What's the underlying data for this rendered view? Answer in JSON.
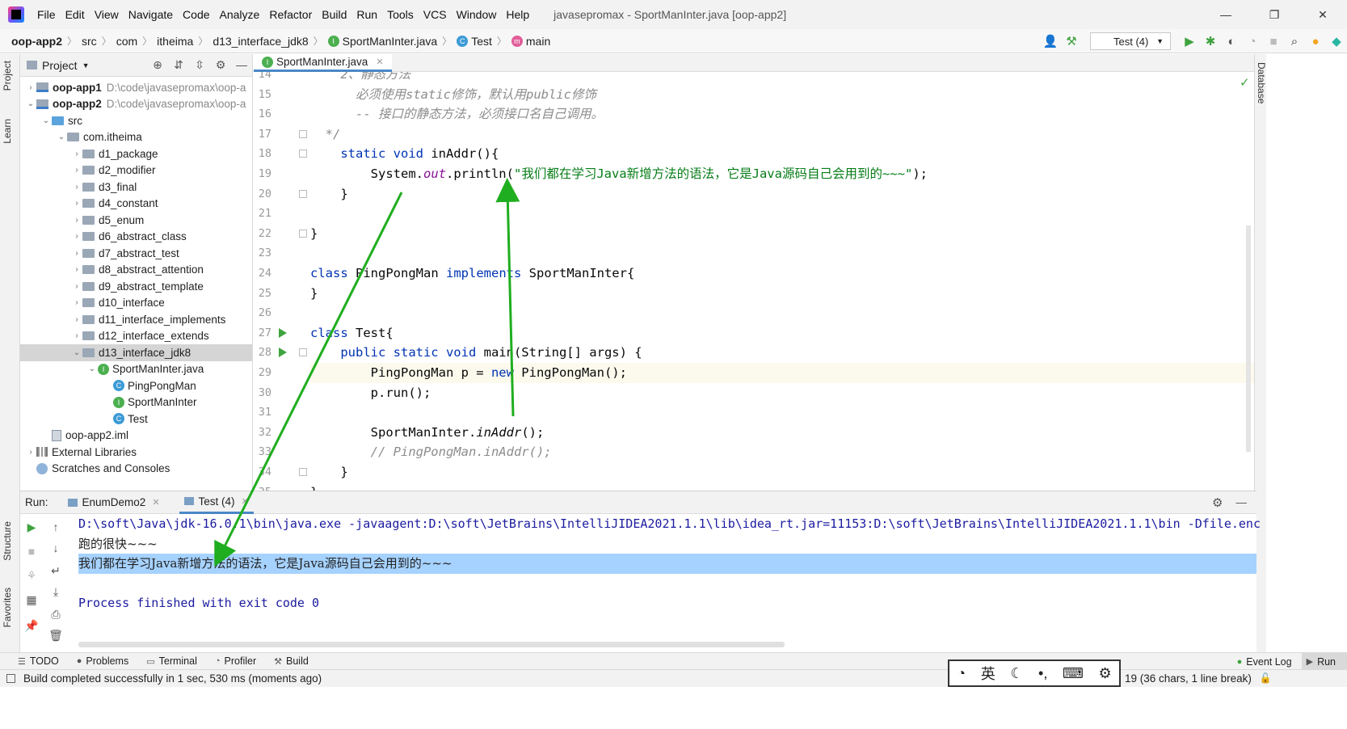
{
  "menubar": {
    "items": [
      "File",
      "Edit",
      "View",
      "Navigate",
      "Code",
      "Analyze",
      "Refactor",
      "Build",
      "Run",
      "Tools",
      "VCS",
      "Window",
      "Help"
    ],
    "window_title": "javasepromax - SportManInter.java [oop-app2]"
  },
  "navbar": {
    "crumbs": [
      "oop-app2",
      "src",
      "com",
      "itheima",
      "d13_interface_jdk8",
      "SportManInter.java",
      "Test",
      "main"
    ],
    "run_config": "Test (4)"
  },
  "left_strip": {
    "project": "Project",
    "learn": "Learn",
    "structure": "Structure",
    "favorites": "Favorites"
  },
  "right_strip": {
    "database": "Database"
  },
  "project": {
    "title": "Project",
    "tree": [
      {
        "label": "oop-app1",
        "path": "D:\\code\\javasepromax\\oop-a",
        "depth": 0,
        "arrow": "›",
        "kind": "module"
      },
      {
        "label": "oop-app2",
        "path": "D:\\code\\javasepromax\\oop-a",
        "depth": 0,
        "arrow": "⌄",
        "kind": "module"
      },
      {
        "label": "src",
        "depth": 1,
        "arrow": "⌄",
        "kind": "src"
      },
      {
        "label": "com.itheima",
        "depth": 2,
        "arrow": "⌄",
        "kind": "folder"
      },
      {
        "label": "d1_package",
        "depth": 3,
        "arrow": "›",
        "kind": "folder"
      },
      {
        "label": "d2_modifier",
        "depth": 3,
        "arrow": "›",
        "kind": "folder"
      },
      {
        "label": "d3_final",
        "depth": 3,
        "arrow": "›",
        "kind": "folder"
      },
      {
        "label": "d4_constant",
        "depth": 3,
        "arrow": "›",
        "kind": "folder"
      },
      {
        "label": "d5_enum",
        "depth": 3,
        "arrow": "›",
        "kind": "folder"
      },
      {
        "label": "d6_abstract_class",
        "depth": 3,
        "arrow": "›",
        "kind": "folder"
      },
      {
        "label": "d7_abstract_test",
        "depth": 3,
        "arrow": "›",
        "kind": "folder"
      },
      {
        "label": "d8_abstract_attention",
        "depth": 3,
        "arrow": "›",
        "kind": "folder"
      },
      {
        "label": "d9_abstract_template",
        "depth": 3,
        "arrow": "›",
        "kind": "folder"
      },
      {
        "label": "d10_interface",
        "depth": 3,
        "arrow": "›",
        "kind": "folder"
      },
      {
        "label": "d11_interface_implements",
        "depth": 3,
        "arrow": "›",
        "kind": "folder"
      },
      {
        "label": "d12_interface_extends",
        "depth": 3,
        "arrow": "›",
        "kind": "folder"
      },
      {
        "label": "d13_interface_jdk8",
        "depth": 3,
        "arrow": "⌄",
        "kind": "folder",
        "selected": true
      },
      {
        "label": "SportManInter.java",
        "depth": 4,
        "arrow": "⌄",
        "kind": "interface"
      },
      {
        "label": "PingPongMan",
        "depth": 5,
        "arrow": "",
        "kind": "class"
      },
      {
        "label": "SportManInter",
        "depth": 5,
        "arrow": "",
        "kind": "interface"
      },
      {
        "label": "Test",
        "depth": 5,
        "arrow": "",
        "kind": "class-run"
      },
      {
        "label": "oop-app2.iml",
        "depth": 1,
        "arrow": "",
        "kind": "iml"
      },
      {
        "label": "External Libraries",
        "depth": 0,
        "arrow": "›",
        "kind": "libs"
      },
      {
        "label": "Scratches and Consoles",
        "depth": 0,
        "arrow": "",
        "kind": "scratch"
      }
    ]
  },
  "editor": {
    "tab": "SportManInter.java",
    "lines": [
      {
        "n": "14",
        "html": "<span class='comment'>    2、静态方法</span>"
      },
      {
        "n": "15",
        "html": "<span class='comment'>      必须使用static修饰，默认用public修饰</span>"
      },
      {
        "n": "16",
        "html": "<span class='comment'>      -- 接口的静态方法，必须接口名自己调用。</span>"
      },
      {
        "n": "17",
        "html": "<span class='comment'>  */</span>"
      },
      {
        "n": "18",
        "html": "    <span class='kw'>static void</span> inAddr(){"
      },
      {
        "n": "19",
        "html": "        System.<span class='static-field'>out</span>.println(<span class='str'>\"我们都在学习Java新增方法的语法，它是Java源码自己会用到的~~~\"</span>);"
      },
      {
        "n": "20",
        "html": "    }"
      },
      {
        "n": "21",
        "html": ""
      },
      {
        "n": "22",
        "html": "}"
      },
      {
        "n": "23",
        "html": ""
      },
      {
        "n": "24",
        "html": "<span class='kw'>class</span> PingPongMan <span class='kw'>implements</span> SportManInter{"
      },
      {
        "n": "25",
        "html": "}"
      },
      {
        "n": "26",
        "html": ""
      },
      {
        "n": "27",
        "html": "<span class='kw'>class</span> Test{"
      },
      {
        "n": "28",
        "html": "    <span class='kw'>public static void</span> main(String[] args) {"
      },
      {
        "n": "29",
        "html": "        PingPongMan p = <span class='kw'>new</span> PingPongMan();"
      },
      {
        "n": "30",
        "html": "        p.run();"
      },
      {
        "n": "31",
        "html": ""
      },
      {
        "n": "32",
        "html": "        SportManInter.<span class='italic'>inAddr</span>();"
      },
      {
        "n": "33",
        "html": "<span class='comment'>        // PingPongMan.inAddr();</span>"
      },
      {
        "n": "34",
        "html": "    }"
      },
      {
        "n": "35",
        "html": "}"
      }
    ]
  },
  "run": {
    "label": "Run:",
    "tabs": [
      "EnumDemo2",
      "Test (4)"
    ],
    "console": [
      {
        "text": "D:\\soft\\Java\\jdk-16.0.1\\bin\\java.exe -javaagent:D:\\soft\\JetBrains\\IntelliJIDEA2021.1.1\\lib\\idea_rt.jar=11153:D:\\soft\\JetBrains\\IntelliJIDEA2021.1.1\\bin -Dfile.enc",
        "cls": "mono"
      },
      {
        "text": "跑的很快~~~",
        "cls": "cn"
      },
      {
        "text": "我们都在学习Java新增方法的语法，它是Java源码自己会用到的~~~",
        "cls": "cn sel"
      },
      {
        "text": "",
        "cls": "mono"
      },
      {
        "text": "Process finished with exit code 0",
        "cls": "mono"
      }
    ]
  },
  "bottom": {
    "tabs": [
      "TODO",
      "Problems",
      "Terminal",
      "Profiler",
      "Build"
    ],
    "event_log": "Event Log",
    "run": "Run"
  },
  "status": {
    "message": "Build completed successfully in 1 sec, 530 ms (moments ago)",
    "position": "19 (36 chars, 1 line break)",
    "ime_lang": "英"
  },
  "colors": {
    "accent": "#4a88c7",
    "run_green": "#3fa33f",
    "annotation_arrow": "#1fae1f",
    "console_selection": "#a6d2ff"
  }
}
